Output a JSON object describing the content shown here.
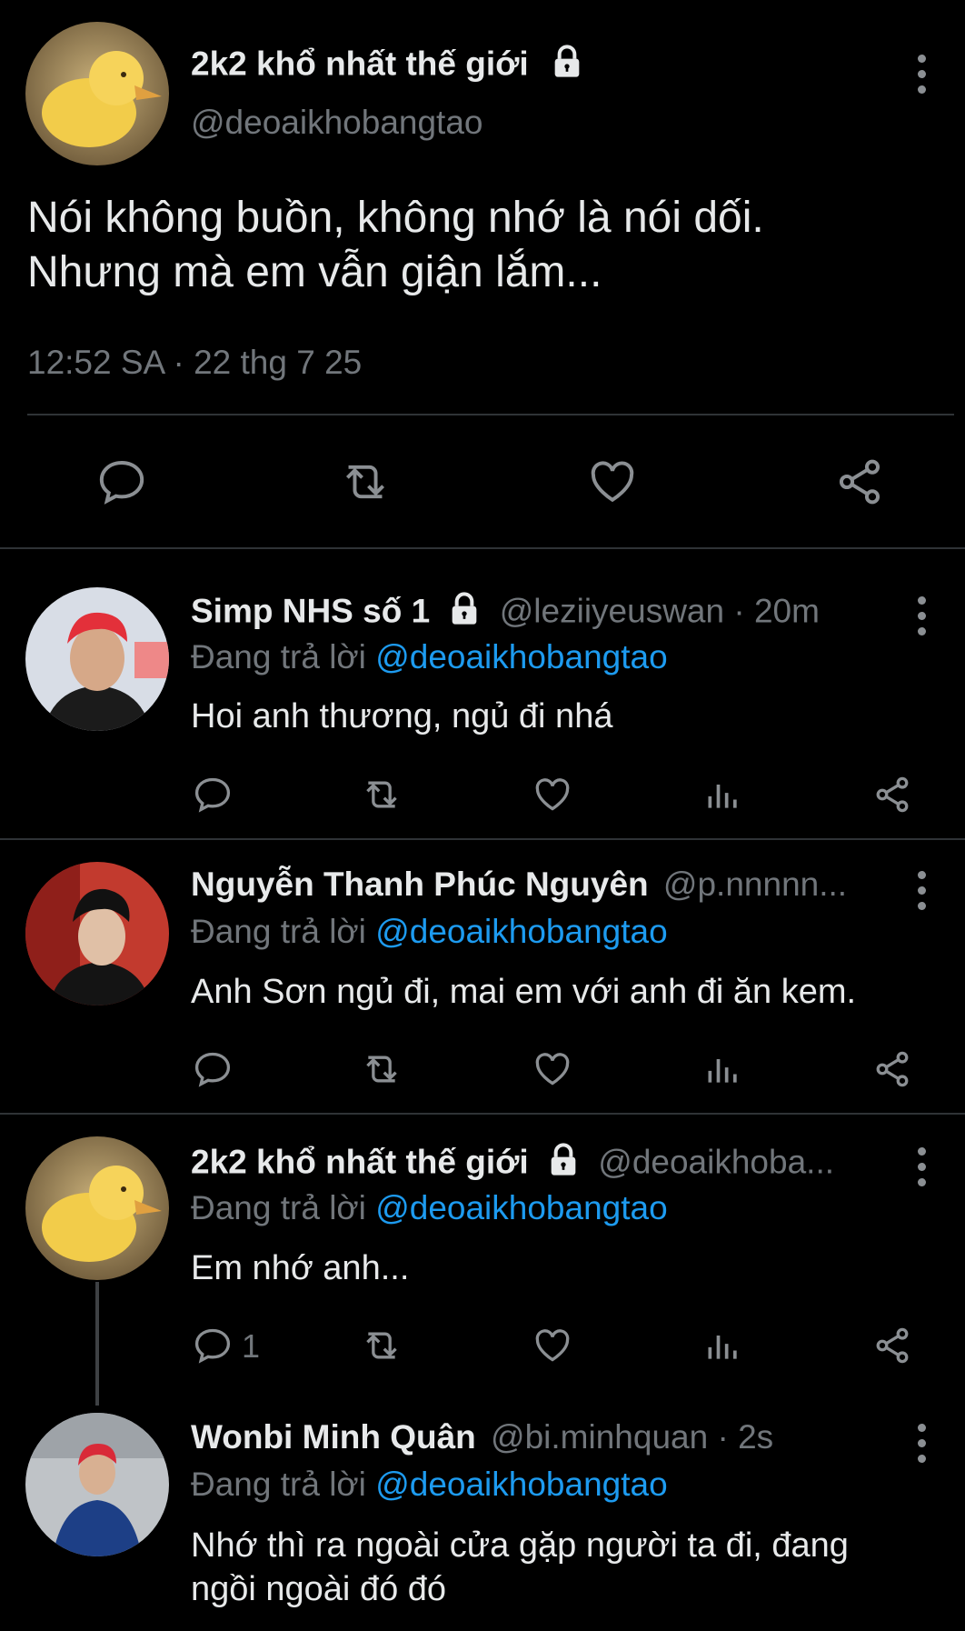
{
  "main_tweet": {
    "display_name": "2k2 khổ nhất thế giới",
    "handle": "@deoaikhobangtao",
    "text_line1": "Nói không buồn, không nhớ là nói dối.",
    "text_line2": "Nhưng mà em vẫn giận lắm...",
    "timestamp": "12:52 SA · 22 thg 7 25"
  },
  "replies": [
    {
      "display_name": "Simp NHS số 1",
      "handle_time": "@leziiyeuswan · 20m",
      "replying_prefix": "Đang trả lời",
      "replying_to": "@deoaikhobangtao",
      "text": "Hoi anh thương, ngủ đi nhá"
    },
    {
      "display_name": "Nguyễn Thanh Phúc Nguyên",
      "handle_time": "@p.nnnnn...",
      "replying_prefix": "Đang trả lời",
      "replying_to": "@deoaikhobangtao",
      "text": "Anh Sơn ngủ đi, mai em với anh đi ăn kem."
    },
    {
      "display_name": "2k2 khổ nhất thế giới",
      "handle_time": "@deoaikhoba...",
      "replying_prefix": "Đang trả lời",
      "replying_to": "@deoaikhobangtao",
      "text": "Em nhớ anh...",
      "reply_count": "1"
    },
    {
      "display_name": "Wonbi Minh Quân",
      "handle_time": "@bi.minhquan · 2s",
      "replying_prefix": "Đang trả lời",
      "replying_to": "@deoaikhobangtao",
      "text_line1": "Nhớ thì ra ngoài cửa gặp người ta đi, đang",
      "text_line2": "ngồi ngoài đó đó"
    }
  ],
  "colors": {
    "background": "#000000",
    "text": "#e7e9ea",
    "muted": "#71767b",
    "link": "#1d9bf0",
    "divider": "#2f3336"
  }
}
